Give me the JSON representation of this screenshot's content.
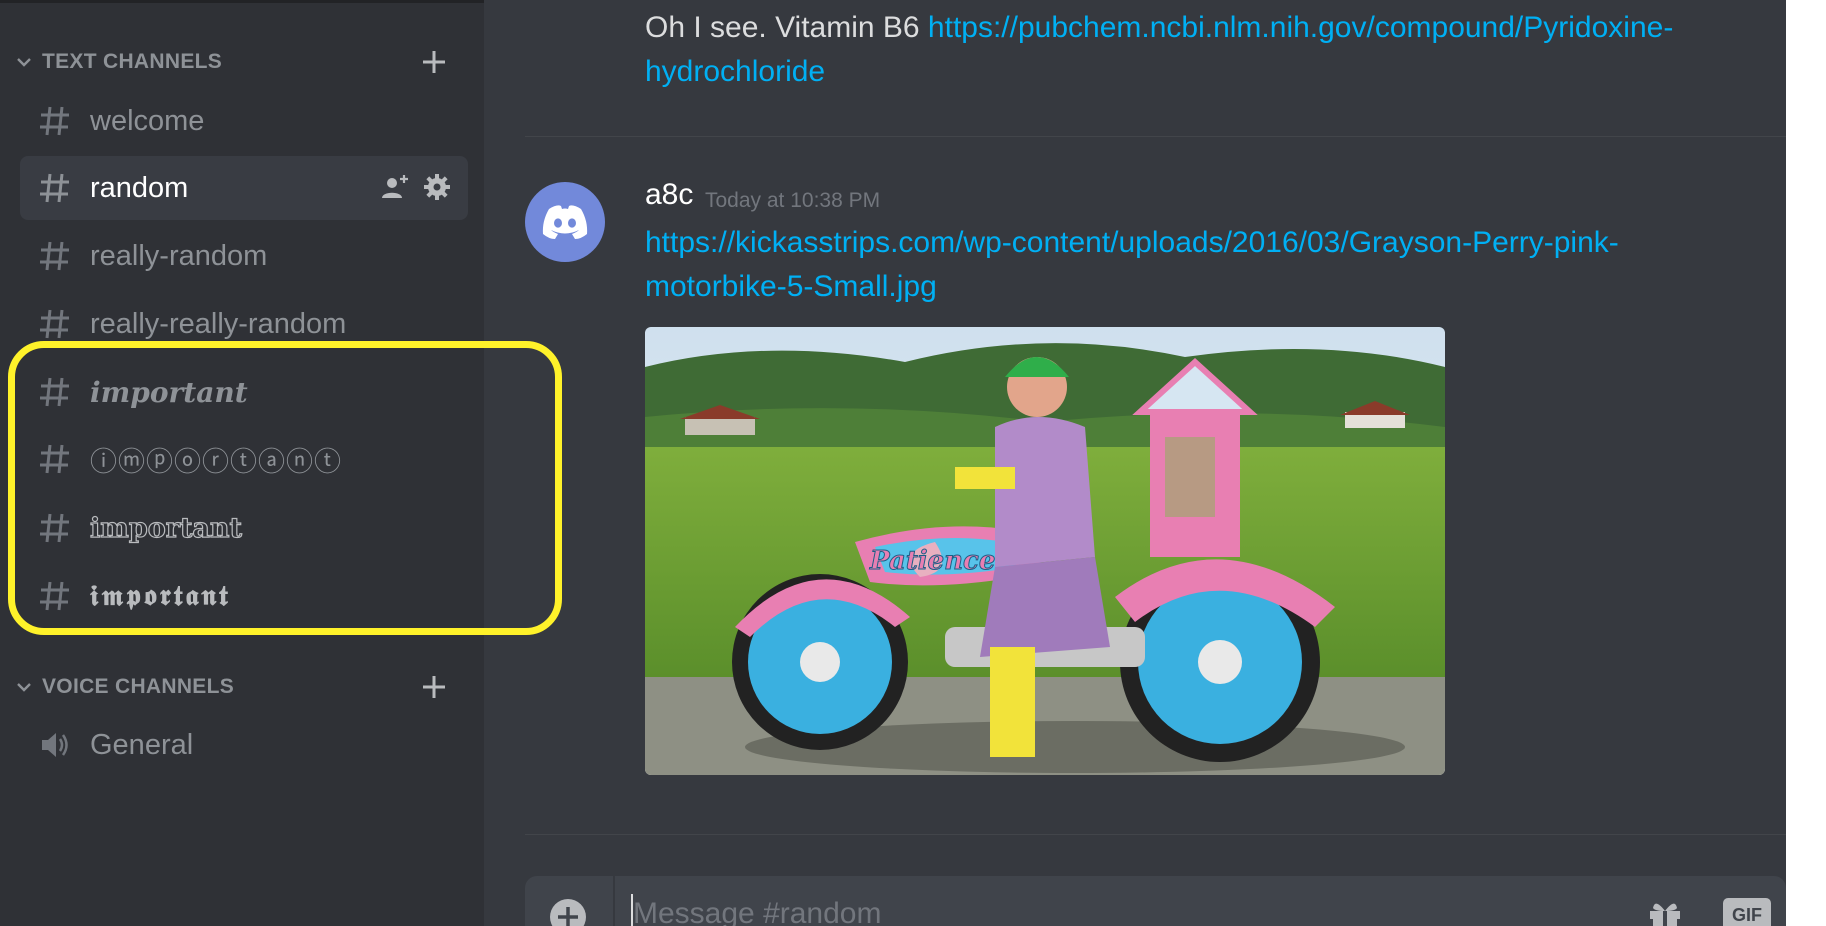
{
  "sidebar": {
    "text_category": {
      "label": "TEXT CHANNELS"
    },
    "voice_category": {
      "label": "VOICE CHANNELS"
    },
    "channels": [
      {
        "name": "welcome"
      },
      {
        "name": "random"
      },
      {
        "name": "really-random"
      },
      {
        "name": "really-really-random"
      },
      {
        "name": "important"
      },
      {
        "name": "ⓘⓜⓟⓞⓡⓣⓐⓝⓣ"
      },
      {
        "name": "important"
      },
      {
        "name": "𝖎𝖒𝖕𝖔𝖗𝖙𝖆𝖓𝖙"
      }
    ],
    "voice_channels": [
      {
        "name": "General"
      }
    ]
  },
  "chat": {
    "message_1": {
      "text": "Oh I see. Vitamin B6 ",
      "link": "https://pubchem.ncbi.nlm.nih.gov/compound/Pyridoxine-hydrochloride"
    },
    "message_2": {
      "author": "a8c",
      "timestamp": "Today at 10:38 PM",
      "link": "https://kickasstrips.com/wp-content/uploads/2016/03/Grayson-Perry-pink-motorbike-5-Small.jpg",
      "caption_text": "Patience"
    },
    "composer": {
      "placeholder": "Message #random",
      "gif_label": "GIF"
    }
  },
  "colors": {
    "app_bg": "#36393f",
    "sidebar_bg": "#2f3136",
    "link": "#00b0f4",
    "highlight": "#fff22a",
    "avatar": "#7289da"
  }
}
